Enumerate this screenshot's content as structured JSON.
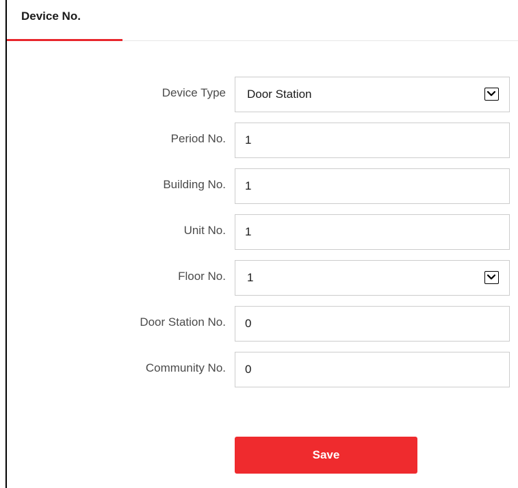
{
  "tabs": [
    {
      "label": "Device No.",
      "active": true
    }
  ],
  "form": {
    "device_type": {
      "label": "Device Type",
      "value": "Door Station"
    },
    "period_no": {
      "label": "Period No.",
      "value": "1"
    },
    "building_no": {
      "label": "Building No.",
      "value": "1"
    },
    "unit_no": {
      "label": "Unit No.",
      "value": "1"
    },
    "floor_no": {
      "label": "Floor No.",
      "value": "1"
    },
    "door_station_no": {
      "label": "Door Station No.",
      "value": "0"
    },
    "community_no": {
      "label": "Community No.",
      "value": "0"
    }
  },
  "actions": {
    "save_label": "Save"
  },
  "colors": {
    "accent": "#ef2b2e",
    "tab_underline": "#e8262c",
    "input_border": "#cccccc",
    "label_text": "#4a4a4a"
  },
  "icons": {
    "dropdown": "chevron-down-icon"
  }
}
